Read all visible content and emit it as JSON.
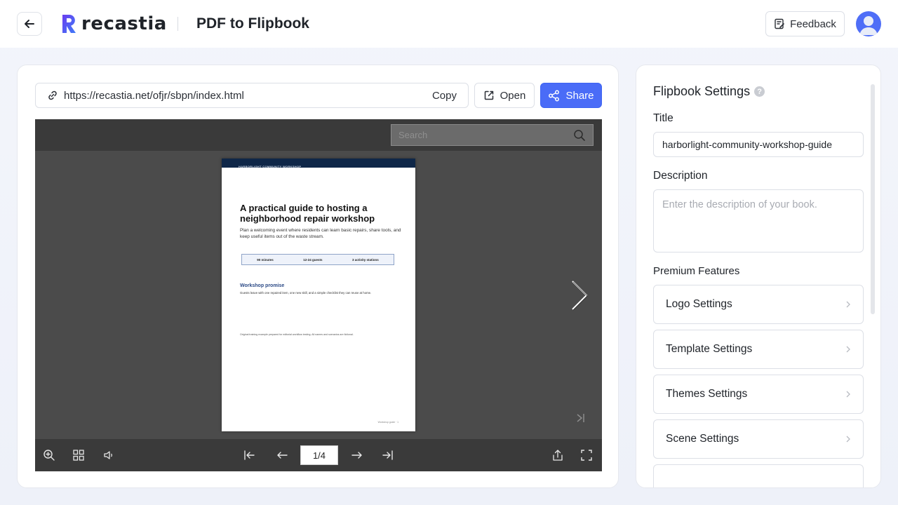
{
  "header": {
    "logo_text": "recastia",
    "page_title": "PDF to Flipbook",
    "feedback_label": "Feedback"
  },
  "share_bar": {
    "url": "https://recastia.net/ofjr/sbpn/index.html",
    "copy_label": "Copy",
    "open_label": "Open",
    "share_label": "Share"
  },
  "viewer": {
    "search_placeholder": "Search",
    "page_indicator": "1/4",
    "page": {
      "band_text": "HARBORLIGHT COMMUNITY WORKSHOP",
      "title": "A practical guide to hosting a neighborhood repair workshop",
      "subtitle": "Plan a welcoming event where residents can learn basic repairs, share tools, and keep useful items out of the waste stream.",
      "stats": [
        "90 minutes",
        "12-24 guests",
        "3 activity stations"
      ],
      "section_heading": "Workshop promise",
      "section_text": "Guests leave with one repaired item, one new skill, and a simple checklist they can reuse at home.",
      "note": "Original training example prepared for editorial workflow testing. All names and scenarios are fictional.",
      "footer": "Workshop guide  ·  1"
    }
  },
  "settings": {
    "heading": "Flipbook Settings",
    "title_label": "Title",
    "title_value": "harborlight-community-workshop-guide",
    "description_label": "Description",
    "description_placeholder": "Enter the description of your book.",
    "premium_label": "Premium Features",
    "features": [
      {
        "label": "Logo Settings"
      },
      {
        "label": "Template Settings"
      },
      {
        "label": "Themes Settings"
      },
      {
        "label": "Scene Settings"
      }
    ]
  },
  "colors": {
    "accent": "#4a6cf7",
    "page_band": "#0f2748",
    "viewer_bg": "#4b4b4b"
  }
}
